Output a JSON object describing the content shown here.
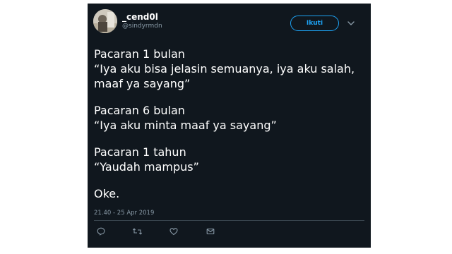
{
  "user": {
    "display_name": "_cend0l",
    "handle": "@sindyrmdn"
  },
  "follow_button": {
    "label": "Ikuti"
  },
  "tweet": {
    "paragraphs": [
      "Pacaran 1 bulan\n“Iya aku bisa jelasin semuanya, iya aku salah, maaf ya sayang”",
      "Pacaran 6 bulan\n“Iya aku minta maaf ya sayang”",
      "Pacaran 1 tahun\n“Yaudah mampus”",
      "Oke."
    ],
    "timestamp": "21.40 - 25 Apr 2019"
  },
  "actions": [
    "reply-icon",
    "retweet-icon",
    "like-icon",
    "message-icon"
  ],
  "colors": {
    "background": "#10171e",
    "text": "#ffffff",
    "secondary": "#8899a6",
    "accent": "#1da1f2"
  }
}
